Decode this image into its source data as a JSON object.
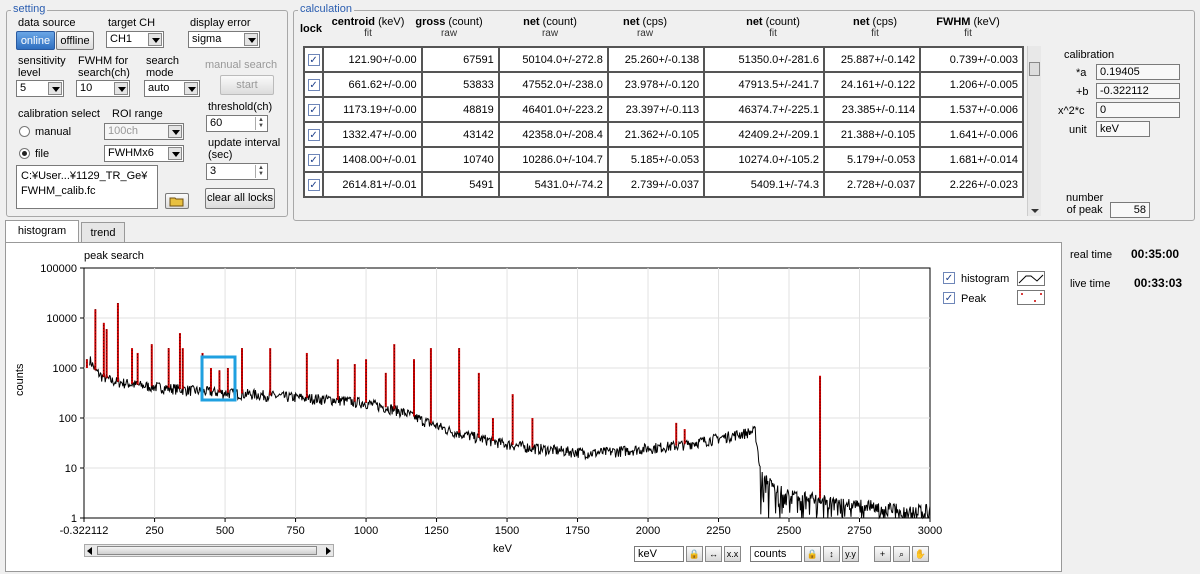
{
  "setting": {
    "title": "setting",
    "data_source_label": "data source",
    "online": "online",
    "offline": "offline",
    "target_ch_label": "target CH",
    "target_ch": "CH1",
    "display_error_label": "display error",
    "display_error": "sigma",
    "sensitivity_label1": "sensitivity",
    "sensitivity_label2": "level",
    "sensitivity": "5",
    "fwhm_label1": "FWHM for",
    "fwhm_label2": "search(ch)",
    "fwhm": "10",
    "search_mode_label1": "search",
    "search_mode_label2": "mode",
    "search_mode": "auto",
    "manual_search_label": "manual search",
    "start": "start",
    "calib_select_label": "calibration select",
    "roi_label": "ROI range",
    "manual": "manual",
    "file": "file",
    "roi_value": "100ch",
    "roi_file": "FWHMx6",
    "threshold_label": "threshold(ch)",
    "threshold": "60",
    "update_label1": "update interval",
    "update_label2": "(sec)",
    "update": "3",
    "path1": "C:¥User...¥1129_TR_Ge¥",
    "path2": "FWHM_calib.fc",
    "clear_locks": "clear all locks"
  },
  "calculation": {
    "title": "calculation",
    "headers": [
      {
        "main": "lock",
        "unit": "",
        "sub": ""
      },
      {
        "main": "centroid",
        "unit": " (keV)",
        "sub": "fit"
      },
      {
        "main": "gross",
        "unit": " (count)",
        "sub": "raw"
      },
      {
        "main": "net",
        "unit": " (count)",
        "sub": "raw"
      },
      {
        "main": "net",
        "unit": " (cps)",
        "sub": "raw"
      },
      {
        "main": "net",
        "unit": " (count)",
        "sub": "fit"
      },
      {
        "main": "net",
        "unit": " (cps)",
        "sub": "fit"
      },
      {
        "main": "FWHM",
        "unit": "  (keV)",
        "sub": "fit"
      }
    ],
    "rows": [
      [
        "121.90+/-0.00",
        "67591",
        "50104.0+/-272.8",
        "25.260+/-0.138",
        "51350.0+/-281.6",
        "25.887+/-0.142",
        "0.739+/-0.003"
      ],
      [
        "661.62+/-0.00",
        "53833",
        "47552.0+/-238.0",
        "23.978+/-0.120",
        "47913.5+/-241.7",
        "24.161+/-0.122",
        "1.206+/-0.005"
      ],
      [
        "1173.19+/-0.00",
        "48819",
        "46401.0+/-223.2",
        "23.397+/-0.113",
        "46374.7+/-225.1",
        "23.385+/-0.114",
        "1.537+/-0.006"
      ],
      [
        "1332.47+/-0.00",
        "43142",
        "42358.0+/-208.4",
        "21.362+/-0.105",
        "42409.2+/-209.1",
        "21.388+/-0.105",
        "1.641+/-0.006"
      ],
      [
        "1408.00+/-0.01",
        "10740",
        "10286.0+/-104.7",
        "5.185+/-0.053",
        "10274.0+/-105.2",
        "5.179+/-0.053",
        "1.681+/-0.014"
      ],
      [
        "2614.81+/-0.01",
        "5491",
        "5431.0+/-74.2",
        "2.739+/-0.037",
        "5409.1+/-74.3",
        "2.728+/-0.037",
        "2.226+/-0.023"
      ]
    ],
    "calibration_label": "calibration",
    "a_label": "*a",
    "a": "0.19405",
    "b_label": "+b",
    "b": "-0.322112",
    "c_label": "x^2*c",
    "c": "0",
    "unit_label": "unit",
    "unit": "keV",
    "npeak_label1": "number",
    "npeak_label2": "of peak",
    "npeak": "58"
  },
  "tabs": [
    "histogram",
    "trend"
  ],
  "status": {
    "real_label": "real time",
    "real": "00:35:00",
    "live_label": "live time",
    "live": "00:33:03"
  },
  "legend": {
    "histogram": "histogram",
    "peak": "Peak"
  },
  "plot_toolbar": {
    "xunit": "keV",
    "yunit": "counts"
  },
  "colors": {
    "histogram": "#000000",
    "peak": "#cc0000",
    "highlight": "#1fa0e0",
    "accent": "#2a5db0"
  },
  "chart_data": {
    "type": "line",
    "title": "peak search",
    "xlabel": "keV",
    "ylabel": "counts",
    "xlim": [
      -0.322112,
      3000
    ],
    "ylim": [
      1,
      100000
    ],
    "yscale": "log",
    "x_ticks": [
      "-0.322112",
      "250",
      "500",
      "750",
      "1000",
      "1250",
      "1500",
      "1750",
      "2000",
      "2250",
      "2500",
      "2750",
      "3000"
    ],
    "y_ticks": [
      "1",
      "10",
      "100",
      "1000",
      "10000",
      "100000"
    ],
    "grid": true,
    "continuum": [
      [
        20,
        1500
      ],
      [
        40,
        900
      ],
      [
        60,
        700
      ],
      [
        100,
        550
      ],
      [
        200,
        450
      ],
      [
        300,
        400
      ],
      [
        400,
        350
      ],
      [
        500,
        320
      ],
      [
        600,
        300
      ],
      [
        700,
        270
      ],
      [
        800,
        250
      ],
      [
        900,
        230
      ],
      [
        1000,
        200
      ],
      [
        1100,
        150
      ],
      [
        1150,
        120
      ],
      [
        1200,
        90
      ],
      [
        1250,
        70
      ],
      [
        1300,
        55
      ],
      [
        1400,
        40
      ],
      [
        1500,
        30
      ],
      [
        1600,
        25
      ],
      [
        1700,
        22
      ],
      [
        1800,
        20
      ],
      [
        1900,
        22
      ],
      [
        2000,
        25
      ],
      [
        2100,
        28
      ],
      [
        2200,
        35
      ],
      [
        2300,
        45
      ],
      [
        2380,
        55
      ],
      [
        2400,
        8
      ],
      [
        2450,
        4
      ],
      [
        2500,
        3
      ],
      [
        2600,
        2.5
      ],
      [
        2700,
        2
      ],
      [
        2800,
        1.8
      ],
      [
        2900,
        1.5
      ],
      [
        3000,
        1.5
      ]
    ],
    "series": [
      {
        "name": "histogram"
      },
      {
        "name": "Peak"
      }
    ],
    "peaks": [
      [
        10,
        1000
      ],
      [
        40,
        15000
      ],
      [
        70,
        8000
      ],
      [
        80,
        6000
      ],
      [
        120,
        20000
      ],
      [
        170,
        2500
      ],
      [
        190,
        2000
      ],
      [
        240,
        3000
      ],
      [
        300,
        2500
      ],
      [
        340,
        5000
      ],
      [
        350,
        2500
      ],
      [
        420,
        2000
      ],
      [
        450,
        1000
      ],
      [
        480,
        900
      ],
      [
        510,
        1000
      ],
      [
        560,
        2500
      ],
      [
        660,
        2500
      ],
      [
        790,
        2000
      ],
      [
        900,
        1500
      ],
      [
        960,
        1200
      ],
      [
        1000,
        1500
      ],
      [
        1070,
        800
      ],
      [
        1100,
        3000
      ],
      [
        1170,
        1500
      ],
      [
        1230,
        2500
      ],
      [
        1330,
        2500
      ],
      [
        1400,
        800
      ],
      [
        1450,
        100
      ],
      [
        1520,
        300
      ],
      [
        1590,
        100
      ],
      [
        2100,
        80
      ],
      [
        2130,
        60
      ],
      [
        2610,
        700
      ]
    ]
  }
}
